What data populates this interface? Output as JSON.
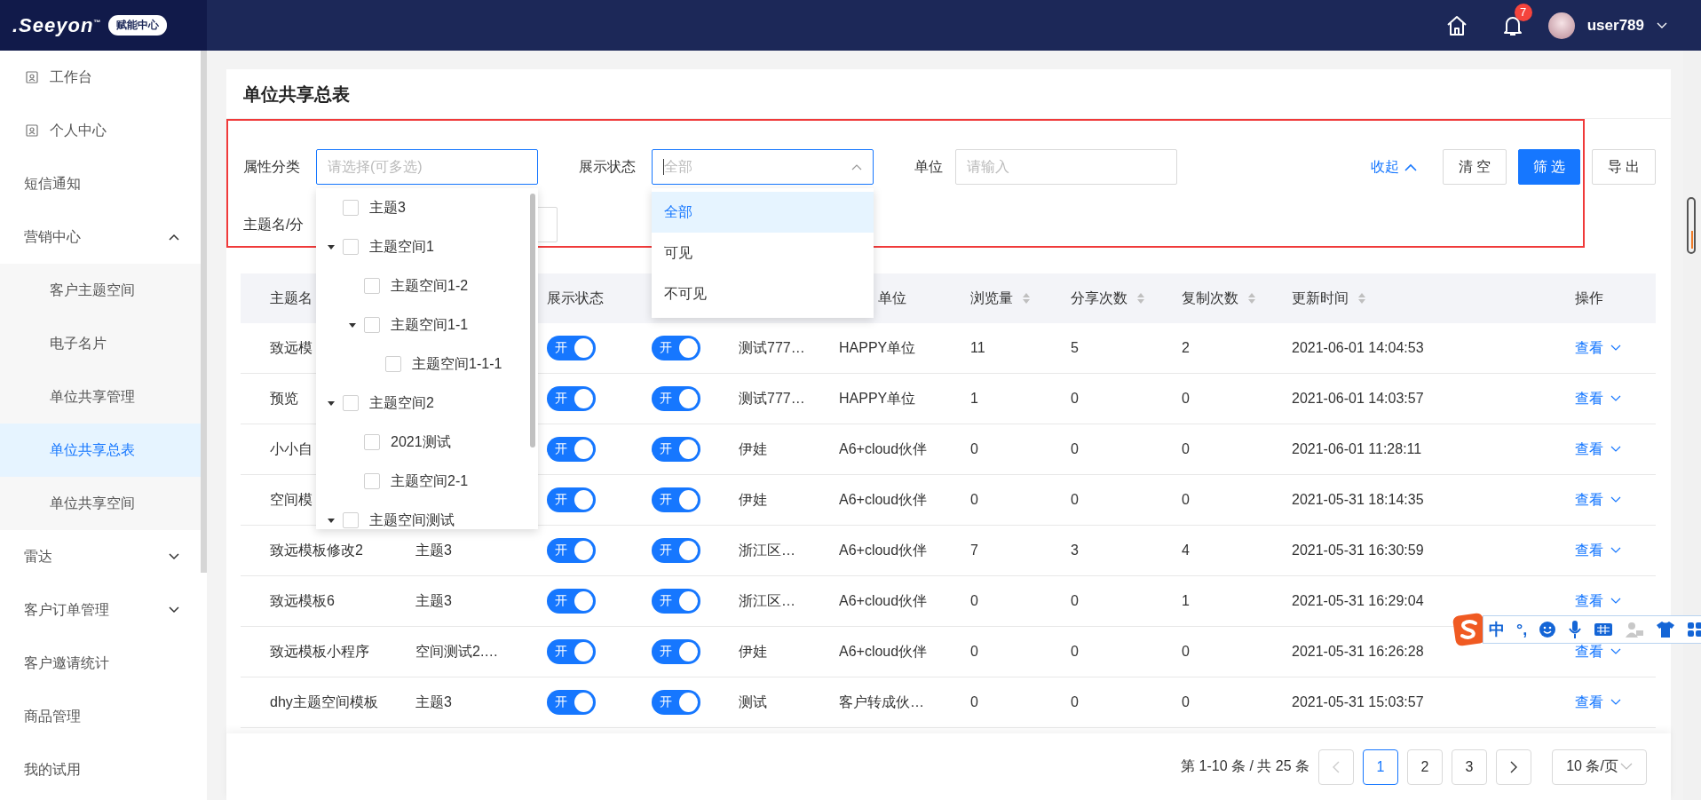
{
  "header": {
    "logo": ".Seeyon",
    "logo_mark": "™",
    "badge": "赋能中心",
    "notifications": "7",
    "user": "user789"
  },
  "sidebar": {
    "items": [
      {
        "label": "工作台",
        "kind": "icon",
        "selected": false
      },
      {
        "label": "个人中心",
        "kind": "icon",
        "selected": false
      },
      {
        "label": "短信通知",
        "kind": "plain",
        "selected": false
      },
      {
        "label": "营销中心",
        "kind": "group",
        "selected": false,
        "expanded": true,
        "children": [
          {
            "label": "客户主题空间",
            "kind": "plain",
            "selected": false
          },
          {
            "label": "电子名片",
            "kind": "plain",
            "selected": false
          },
          {
            "label": "单位共享管理",
            "kind": "plain",
            "selected": false
          },
          {
            "label": "单位共享总表",
            "kind": "plain",
            "selected": true
          },
          {
            "label": "单位共享空间",
            "kind": "plain",
            "selected": false
          }
        ]
      },
      {
        "label": "雷达",
        "kind": "group",
        "selected": false,
        "expanded": false
      },
      {
        "label": "客户订单管理",
        "kind": "group",
        "selected": false,
        "expanded": false
      },
      {
        "label": "客户邀请统计",
        "kind": "plain",
        "selected": false
      },
      {
        "label": "商品管理",
        "kind": "plain",
        "selected": false
      },
      {
        "label": "我的试用",
        "kind": "plain",
        "selected": false
      }
    ]
  },
  "page_title": "单位共享总表",
  "filters": {
    "category": {
      "label": "属性分类",
      "placeholder": "请选择(可多选)",
      "tree": [
        {
          "label": "主题3",
          "checked": false
        },
        {
          "label": "主题空间1",
          "checked": false,
          "expanded": true,
          "children": [
            {
              "label": "主题空间1-2",
              "checked": false
            },
            {
              "label": "主题空间1-1",
              "checked": false,
              "expanded": true,
              "children": [
                {
                  "label": "主题空间1-1-1",
                  "checked": false
                }
              ]
            }
          ]
        },
        {
          "label": "主题空间2",
          "checked": false,
          "expanded": true,
          "children": [
            {
              "label": "2021测试",
              "checked": false
            },
            {
              "label": "主题空间2-1",
              "checked": false
            }
          ]
        },
        {
          "label": "主题空间测试",
          "checked": false,
          "expanded": true
        }
      ]
    },
    "status": {
      "label": "展示状态",
      "placeholder": "全部",
      "options": [
        {
          "label": "全部",
          "selected": true
        },
        {
          "label": "可见",
          "selected": false
        },
        {
          "label": "不可见",
          "selected": false
        }
      ]
    },
    "unit": {
      "label": "单位",
      "placeholder": "请输入"
    },
    "theme": {
      "label": "主题名/分"
    },
    "collapse": "收起",
    "buttons": [
      {
        "label": "清 空",
        "kind": "default"
      },
      {
        "label": "筛 选",
        "kind": "primary"
      },
      {
        "label": "导 出",
        "kind": "default"
      }
    ]
  },
  "table": {
    "headers": {
      "name": {
        "label": "主题名"
      },
      "display_toggle": {
        "label": "展示状态",
        "sortable": false
      },
      "unit": {
        "label": "单位",
        "sortable": false
      },
      "views": {
        "label": "浏览量",
        "sortable": true
      },
      "shares": {
        "label": "分享次数",
        "sortable": true
      },
      "copies": {
        "label": "复制次数",
        "sortable": true
      },
      "updated": {
        "label": "更新时间",
        "sortable": true
      },
      "action": {
        "label": "操作",
        "sortable": false
      }
    },
    "rows": [
      {
        "name": "致远模",
        "display_toggle": {
          "label": "开",
          "on": true
        },
        "column_4_toggle": {
          "label": "开",
          "on": true
        },
        "column_5": "测试777…",
        "unit": "HAPPY单位",
        "views": "11",
        "shares": "5",
        "copies": "2",
        "updated": "2021-06-01 14:04:53",
        "action": "查看"
      },
      {
        "name": "预览",
        "display_toggle": {
          "label": "开",
          "on": true
        },
        "column_4_toggle": {
          "label": "开",
          "on": true
        },
        "column_5": "测试777…",
        "unit": "HAPPY单位",
        "views": "1",
        "shares": "0",
        "copies": "0",
        "updated": "2021-06-01 14:03:57",
        "action": "查看"
      },
      {
        "name": "小小自",
        "display_toggle": {
          "label": "开",
          "on": true
        },
        "column_4_toggle": {
          "label": "开",
          "on": true
        },
        "column_5": "伊娃",
        "unit": "A6+cloud伙伴",
        "views": "0",
        "shares": "0",
        "copies": "0",
        "updated": "2021-06-01 11:28:11",
        "action": "查看"
      },
      {
        "name": "空间模",
        "display_toggle": {
          "label": "开",
          "on": true
        },
        "column_4_toggle": {
          "label": "开",
          "on": true
        },
        "column_5": "伊娃",
        "unit": "A6+cloud伙伴",
        "views": "0",
        "shares": "0",
        "copies": "0",
        "updated": "2021-05-31 18:14:35",
        "action": "查看"
      },
      {
        "name": "致远模板修改2",
        "column_2": "主题3",
        "display_toggle": {
          "label": "开",
          "on": true
        },
        "column_4_toggle": {
          "label": "开",
          "on": true
        },
        "column_5": "浙江区…",
        "unit": "A6+cloud伙伴",
        "views": "7",
        "shares": "3",
        "copies": "4",
        "updated": "2021-05-31 16:30:59",
        "action": "查看"
      },
      {
        "name": "致远模板6",
        "column_2": "主题3",
        "display_toggle": {
          "label": "开",
          "on": true
        },
        "column_4_toggle": {
          "label": "开",
          "on": true
        },
        "column_5": "浙江区…",
        "unit": "A6+cloud伙伴",
        "views": "0",
        "shares": "0",
        "copies": "1",
        "updated": "2021-05-31 16:29:04",
        "action": "查看"
      },
      {
        "name": "致远模板小程序",
        "column_2": "空间测试2.…",
        "display_toggle": {
          "label": "开",
          "on": true
        },
        "column_4_toggle": {
          "label": "开",
          "on": true
        },
        "column_5": "伊娃",
        "unit": "A6+cloud伙伴",
        "views": "0",
        "shares": "0",
        "copies": "0",
        "updated": "2021-05-31 16:26:28",
        "action": "查看"
      },
      {
        "name": "dhy主题空间模板",
        "column_2": "主题3",
        "display_toggle": {
          "label": "开",
          "on": true
        },
        "column_4_toggle": {
          "label": "开",
          "on": true
        },
        "column_5": "测试",
        "unit": "客户转成伙…",
        "views": "0",
        "shares": "0",
        "copies": "0",
        "updated": "2021-05-31 15:03:57",
        "action": "查看"
      }
    ]
  },
  "pagination": {
    "summary": "第 1-10 条 / 共 25 条",
    "prev": {
      "disabled": true
    },
    "pages": [
      {
        "label": "1",
        "selected": true
      },
      {
        "label": "2",
        "selected": false
      },
      {
        "label": "3",
        "selected": false
      }
    ],
    "next": {
      "disabled": false
    },
    "page_size": "10 条/页"
  },
  "ime_toolbar": {
    "mode": "中",
    "punctuation": "°,"
  }
}
